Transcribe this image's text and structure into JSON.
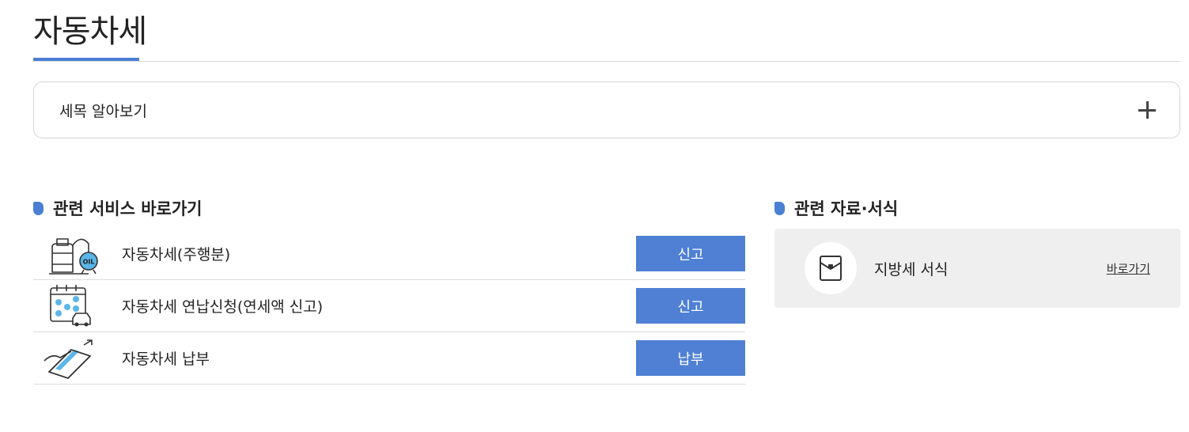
{
  "page": {
    "title": "자동차세"
  },
  "accordion": {
    "label": "세목 알아보기",
    "icon": "plus-icon"
  },
  "related_services": {
    "heading": "관련 서비스 바로가기",
    "items": [
      {
        "label": "자동차세(주행분)",
        "button": "신고",
        "icon": "oil-tank-icon"
      },
      {
        "label": "자동차세 연납신청(연세액 신고)",
        "button": "신고",
        "icon": "calendar-car-icon"
      },
      {
        "label": "자동차세 납부",
        "button": "납부",
        "icon": "card-payment-icon"
      }
    ]
  },
  "related_forms": {
    "heading": "관련 자료·서식",
    "item_label": "지방세 서식",
    "link": "바로가기",
    "icon": "document-folder-icon"
  },
  "colors": {
    "accent": "#4a7fd4",
    "button": "#4f80d4",
    "box_bg": "#efefef"
  }
}
